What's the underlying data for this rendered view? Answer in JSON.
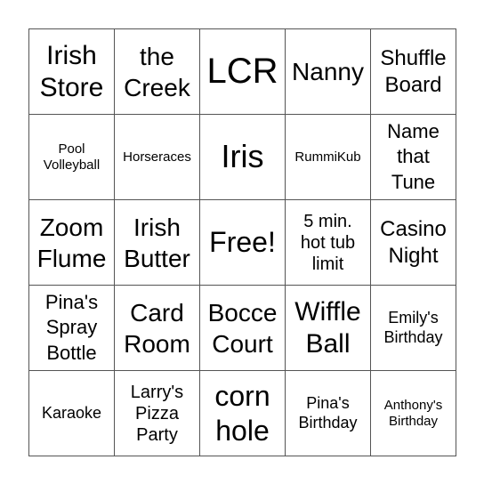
{
  "board": {
    "cells": [
      "Irish\nStore",
      "the\nCreek",
      "LCR",
      "Nanny",
      "Shuffle\nBoard",
      "Pool\nVolleyball",
      "Horseraces",
      "Iris",
      "RummiKub",
      "Name\nthat\nTune",
      "Zoom\nFlume",
      "Irish\nButter",
      "Free!",
      "5 min.\nhot tub\nlimit",
      "Casino\nNight",
      "Pina's\nSpray\nBottle",
      "Card\nRoom",
      "Bocce\nCourt",
      "Wiffle\nBall",
      "Emily's\nBirthday",
      "Karaoke",
      "Larry's\nPizza\nParty",
      "corn\nhole",
      "Pina's\nBirthday",
      "Anthony's\nBirthday"
    ]
  }
}
